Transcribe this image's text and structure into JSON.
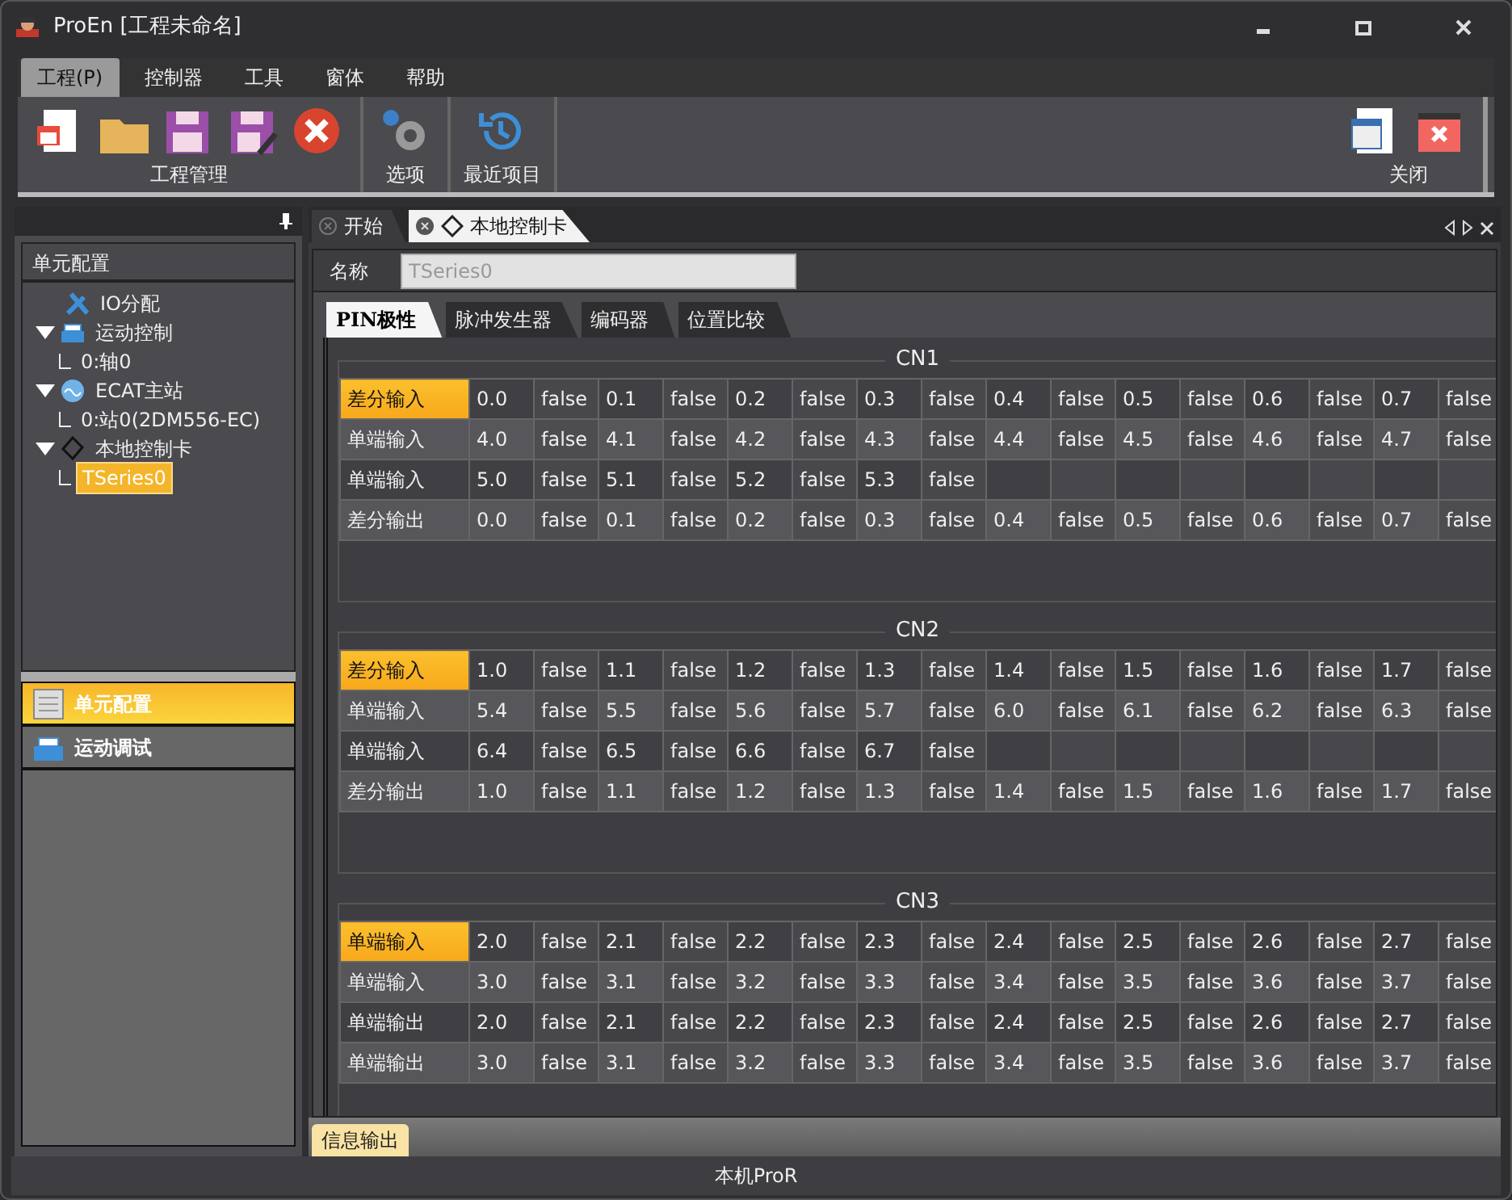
{
  "window": {
    "title": "ProEn [工程未命名]"
  },
  "menu": [
    {
      "label": "工程(P)",
      "selected": true
    },
    {
      "label": "控制器",
      "selected": false
    },
    {
      "label": "工具",
      "selected": false
    },
    {
      "label": "窗体",
      "selected": false
    },
    {
      "label": "帮助",
      "selected": false
    }
  ],
  "toolbar": {
    "groups": [
      {
        "kind": "project",
        "label": "工程管理"
      },
      {
        "kind": "options",
        "label": "选项"
      },
      {
        "kind": "recent",
        "label": "最近项目"
      }
    ],
    "right_group": {
      "kind": "close",
      "label": "关闭"
    }
  },
  "sidebar": {
    "title": "单元配置",
    "tree": [
      {
        "kind": "tool",
        "label": "IO分配",
        "selected": false
      },
      {
        "kind": "motion",
        "label": "运动控制",
        "selected": false,
        "expanded": true,
        "children": [
          {
            "label": "0:轴0",
            "selected": false
          }
        ]
      },
      {
        "kind": "ecat",
        "label": "ECAT主站",
        "selected": false,
        "expanded": true,
        "children": [
          {
            "label": "0:站0(2DM556-EC)",
            "selected": false
          }
        ]
      },
      {
        "kind": "card",
        "label": "本地控制卡",
        "selected": false,
        "expanded": true,
        "children": [
          {
            "label": "TSeries0",
            "selected": true
          }
        ]
      }
    ],
    "nav": [
      {
        "kind": "config",
        "label": "单元配置",
        "selected": true
      },
      {
        "kind": "motion",
        "label": "运动调试",
        "selected": false
      }
    ]
  },
  "doc_tabs": [
    {
      "label": "开始",
      "selected": false
    },
    {
      "label": "本地控制卡",
      "selected": true
    }
  ],
  "name_field": {
    "label": "名称",
    "value": "TSeries0"
  },
  "sub_tabs": [
    {
      "label": "PIN极性",
      "selected": true
    },
    {
      "label": "脉冲发生器",
      "selected": false
    },
    {
      "label": "编码器",
      "selected": false
    },
    {
      "label": "位置比较",
      "selected": false
    }
  ],
  "groups": [
    {
      "title": "CN1",
      "rows": [
        {
          "label": "差分输入",
          "selected": true,
          "cells": [
            "0.0",
            "false",
            "0.1",
            "false",
            "0.2",
            "false",
            "0.3",
            "false",
            "0.4",
            "false",
            "0.5",
            "false",
            "0.6",
            "false",
            "0.7",
            "false"
          ]
        },
        {
          "label": "单端输入",
          "selected": false,
          "cells": [
            "4.0",
            "false",
            "4.1",
            "false",
            "4.2",
            "false",
            "4.3",
            "false",
            "4.4",
            "false",
            "4.5",
            "false",
            "4.6",
            "false",
            "4.7",
            "false"
          ]
        },
        {
          "label": "单端输入",
          "selected": false,
          "cells": [
            "5.0",
            "false",
            "5.1",
            "false",
            "5.2",
            "false",
            "5.3",
            "false"
          ]
        },
        {
          "label": "差分输出",
          "selected": false,
          "cells": [
            "0.0",
            "false",
            "0.1",
            "false",
            "0.2",
            "false",
            "0.3",
            "false",
            "0.4",
            "false",
            "0.5",
            "false",
            "0.6",
            "false",
            "0.7",
            "false"
          ]
        }
      ]
    },
    {
      "title": "CN2",
      "rows": [
        {
          "label": "差分输入",
          "selected": true,
          "cells": [
            "1.0",
            "false",
            "1.1",
            "false",
            "1.2",
            "false",
            "1.3",
            "false",
            "1.4",
            "false",
            "1.5",
            "false",
            "1.6",
            "false",
            "1.7",
            "false"
          ]
        },
        {
          "label": "单端输入",
          "selected": false,
          "cells": [
            "5.4",
            "false",
            "5.5",
            "false",
            "5.6",
            "false",
            "5.7",
            "false",
            "6.0",
            "false",
            "6.1",
            "false",
            "6.2",
            "false",
            "6.3",
            "false"
          ]
        },
        {
          "label": "单端输入",
          "selected": false,
          "cells": [
            "6.4",
            "false",
            "6.5",
            "false",
            "6.6",
            "false",
            "6.7",
            "false"
          ]
        },
        {
          "label": "差分输出",
          "selected": false,
          "cells": [
            "1.0",
            "false",
            "1.1",
            "false",
            "1.2",
            "false",
            "1.3",
            "false",
            "1.4",
            "false",
            "1.5",
            "false",
            "1.6",
            "false",
            "1.7",
            "false"
          ]
        }
      ]
    },
    {
      "title": "CN3",
      "rows": [
        {
          "label": "单端输入",
          "selected": true,
          "cells": [
            "2.0",
            "false",
            "2.1",
            "false",
            "2.2",
            "false",
            "2.3",
            "false",
            "2.4",
            "false",
            "2.5",
            "false",
            "2.6",
            "false",
            "2.7",
            "false"
          ]
        },
        {
          "label": "单端输入",
          "selected": false,
          "cells": [
            "3.0",
            "false",
            "3.1",
            "false",
            "3.2",
            "false",
            "3.3",
            "false",
            "3.4",
            "false",
            "3.5",
            "false",
            "3.6",
            "false",
            "3.7",
            "false"
          ]
        },
        {
          "label": "单端输出",
          "selected": false,
          "cells": [
            "2.0",
            "false",
            "2.1",
            "false",
            "2.2",
            "false",
            "2.3",
            "false",
            "2.4",
            "false",
            "2.5",
            "false",
            "2.6",
            "false",
            "2.7",
            "false"
          ]
        },
        {
          "label": "单端输出",
          "selected": false,
          "cells": [
            "3.0",
            "false",
            "3.1",
            "false",
            "3.2",
            "false",
            "3.3",
            "false",
            "3.4",
            "false",
            "3.5",
            "false",
            "3.6",
            "false",
            "3.7",
            "false"
          ]
        }
      ]
    }
  ],
  "output_tab": {
    "label": "信息输出",
    "selected": true
  },
  "status_bar": {
    "text": "本机ProR"
  }
}
